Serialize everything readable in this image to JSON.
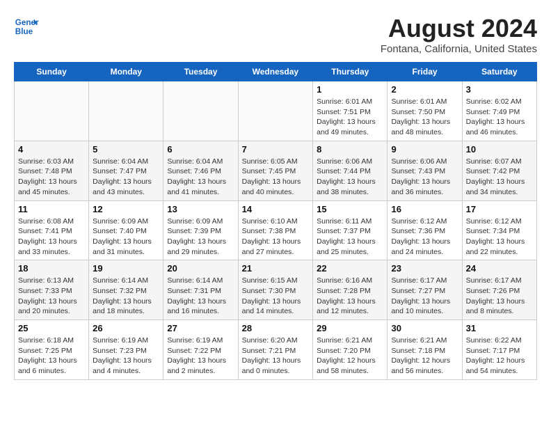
{
  "header": {
    "logo_line1": "General",
    "logo_line2": "Blue",
    "month_year": "August 2024",
    "location": "Fontana, California, United States"
  },
  "weekdays": [
    "Sunday",
    "Monday",
    "Tuesday",
    "Wednesday",
    "Thursday",
    "Friday",
    "Saturday"
  ],
  "weeks": [
    [
      {
        "day": "",
        "info": ""
      },
      {
        "day": "",
        "info": ""
      },
      {
        "day": "",
        "info": ""
      },
      {
        "day": "",
        "info": ""
      },
      {
        "day": "1",
        "info": "Sunrise: 6:01 AM\nSunset: 7:51 PM\nDaylight: 13 hours\nand 49 minutes."
      },
      {
        "day": "2",
        "info": "Sunrise: 6:01 AM\nSunset: 7:50 PM\nDaylight: 13 hours\nand 48 minutes."
      },
      {
        "day": "3",
        "info": "Sunrise: 6:02 AM\nSunset: 7:49 PM\nDaylight: 13 hours\nand 46 minutes."
      }
    ],
    [
      {
        "day": "4",
        "info": "Sunrise: 6:03 AM\nSunset: 7:48 PM\nDaylight: 13 hours\nand 45 minutes."
      },
      {
        "day": "5",
        "info": "Sunrise: 6:04 AM\nSunset: 7:47 PM\nDaylight: 13 hours\nand 43 minutes."
      },
      {
        "day": "6",
        "info": "Sunrise: 6:04 AM\nSunset: 7:46 PM\nDaylight: 13 hours\nand 41 minutes."
      },
      {
        "day": "7",
        "info": "Sunrise: 6:05 AM\nSunset: 7:45 PM\nDaylight: 13 hours\nand 40 minutes."
      },
      {
        "day": "8",
        "info": "Sunrise: 6:06 AM\nSunset: 7:44 PM\nDaylight: 13 hours\nand 38 minutes."
      },
      {
        "day": "9",
        "info": "Sunrise: 6:06 AM\nSunset: 7:43 PM\nDaylight: 13 hours\nand 36 minutes."
      },
      {
        "day": "10",
        "info": "Sunrise: 6:07 AM\nSunset: 7:42 PM\nDaylight: 13 hours\nand 34 minutes."
      }
    ],
    [
      {
        "day": "11",
        "info": "Sunrise: 6:08 AM\nSunset: 7:41 PM\nDaylight: 13 hours\nand 33 minutes."
      },
      {
        "day": "12",
        "info": "Sunrise: 6:09 AM\nSunset: 7:40 PM\nDaylight: 13 hours\nand 31 minutes."
      },
      {
        "day": "13",
        "info": "Sunrise: 6:09 AM\nSunset: 7:39 PM\nDaylight: 13 hours\nand 29 minutes."
      },
      {
        "day": "14",
        "info": "Sunrise: 6:10 AM\nSunset: 7:38 PM\nDaylight: 13 hours\nand 27 minutes."
      },
      {
        "day": "15",
        "info": "Sunrise: 6:11 AM\nSunset: 7:37 PM\nDaylight: 13 hours\nand 25 minutes."
      },
      {
        "day": "16",
        "info": "Sunrise: 6:12 AM\nSunset: 7:36 PM\nDaylight: 13 hours\nand 24 minutes."
      },
      {
        "day": "17",
        "info": "Sunrise: 6:12 AM\nSunset: 7:34 PM\nDaylight: 13 hours\nand 22 minutes."
      }
    ],
    [
      {
        "day": "18",
        "info": "Sunrise: 6:13 AM\nSunset: 7:33 PM\nDaylight: 13 hours\nand 20 minutes."
      },
      {
        "day": "19",
        "info": "Sunrise: 6:14 AM\nSunset: 7:32 PM\nDaylight: 13 hours\nand 18 minutes."
      },
      {
        "day": "20",
        "info": "Sunrise: 6:14 AM\nSunset: 7:31 PM\nDaylight: 13 hours\nand 16 minutes."
      },
      {
        "day": "21",
        "info": "Sunrise: 6:15 AM\nSunset: 7:30 PM\nDaylight: 13 hours\nand 14 minutes."
      },
      {
        "day": "22",
        "info": "Sunrise: 6:16 AM\nSunset: 7:28 PM\nDaylight: 13 hours\nand 12 minutes."
      },
      {
        "day": "23",
        "info": "Sunrise: 6:17 AM\nSunset: 7:27 PM\nDaylight: 13 hours\nand 10 minutes."
      },
      {
        "day": "24",
        "info": "Sunrise: 6:17 AM\nSunset: 7:26 PM\nDaylight: 13 hours\nand 8 minutes."
      }
    ],
    [
      {
        "day": "25",
        "info": "Sunrise: 6:18 AM\nSunset: 7:25 PM\nDaylight: 13 hours\nand 6 minutes."
      },
      {
        "day": "26",
        "info": "Sunrise: 6:19 AM\nSunset: 7:23 PM\nDaylight: 13 hours\nand 4 minutes."
      },
      {
        "day": "27",
        "info": "Sunrise: 6:19 AM\nSunset: 7:22 PM\nDaylight: 13 hours\nand 2 minutes."
      },
      {
        "day": "28",
        "info": "Sunrise: 6:20 AM\nSunset: 7:21 PM\nDaylight: 13 hours\nand 0 minutes."
      },
      {
        "day": "29",
        "info": "Sunrise: 6:21 AM\nSunset: 7:20 PM\nDaylight: 12 hours\nand 58 minutes."
      },
      {
        "day": "30",
        "info": "Sunrise: 6:21 AM\nSunset: 7:18 PM\nDaylight: 12 hours\nand 56 minutes."
      },
      {
        "day": "31",
        "info": "Sunrise: 6:22 AM\nSunset: 7:17 PM\nDaylight: 12 hours\nand 54 minutes."
      }
    ]
  ]
}
